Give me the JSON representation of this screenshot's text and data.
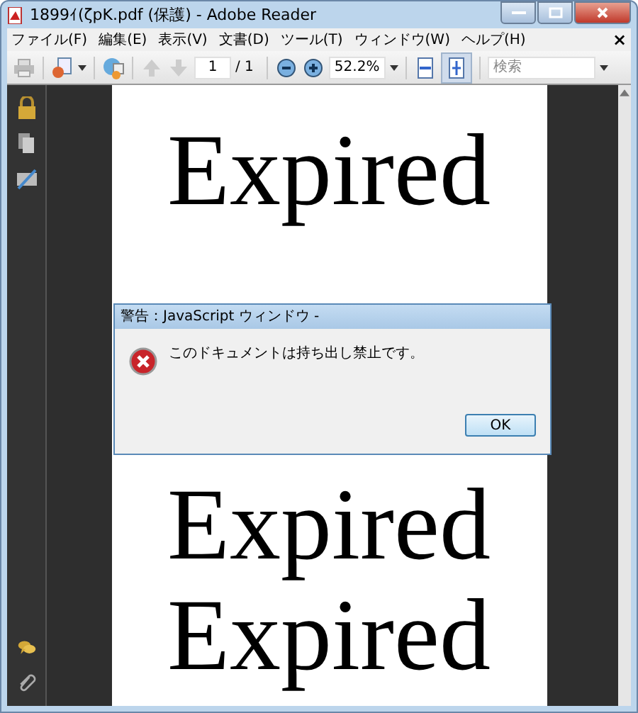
{
  "window": {
    "title": "1899ｲ(ζpK.pdf (保護) - Adobe Reader"
  },
  "menu": {
    "items": [
      "ファイル(F)",
      "編集(E)",
      "表示(V)",
      "文書(D)",
      "ツール(T)",
      "ウィンドウ(W)",
      "ヘルプ(H)"
    ],
    "close": "×"
  },
  "toolbar": {
    "page": "1",
    "page_total": "/ 1",
    "zoom": "52.2%",
    "search": {
      "placeholder": "検索"
    },
    "fit_page_selected": true
  },
  "document": {
    "lines": [
      "Expired",
      "Expired",
      "Expired"
    ]
  },
  "dialog": {
    "title": "警告：JavaScript ウィンドウ -",
    "message": "このドキュメントは持ち出し禁止です。",
    "button": "OK"
  }
}
